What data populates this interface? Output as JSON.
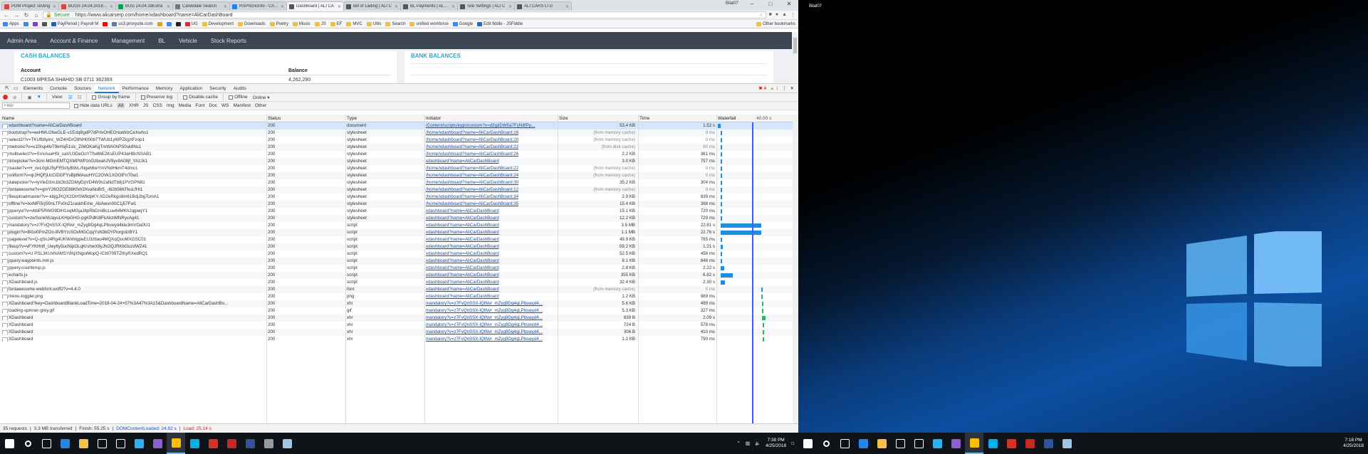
{
  "browser": {
    "profile": "Bilal07",
    "tabs": [
      {
        "label": "PDM Project Testing",
        "color": "#d44638"
      },
      {
        "label": "BUGS 24.04.2018 No",
        "color": "#d44638"
      },
      {
        "label": "BUG 24.04.18Extra",
        "color": "#0f9d58"
      },
      {
        "label": "Candidate Search",
        "color": "#777777"
      },
      {
        "label": "RSPNcricinfo - Cricke",
        "color": "#1e88e5"
      },
      {
        "label": "Dashboard | ALI CA",
        "color": "#555555"
      },
      {
        "label": "Bill of Lading | ALI C",
        "color": "#555555"
      },
      {
        "label": "BL Payments | ALI C",
        "color": "#555555"
      },
      {
        "label": "Site Settings | ALI C",
        "color": "#555555"
      },
      {
        "label": "ALI CARS LTD",
        "color": "#555555"
      }
    ],
    "active_tab": 5,
    "secure_label": "Secure",
    "url": "https://www.alicarserp.com/home/xdashboard?name=AliCarDashBoard",
    "bookmarks": [
      {
        "label": "Apps",
        "color": "#4285f4"
      },
      {
        "label": "",
        "color": "#3c8ad8"
      },
      {
        "label": "",
        "color": "#7b3fc4"
      },
      {
        "label": "",
        "color": "#555555"
      },
      {
        "label": "PayPeriod | Payroll M",
        "color": "#2563a8"
      },
      {
        "label": "",
        "color": "#ff0000"
      },
      {
        "label": "us3.proxysite.com",
        "color": "#5a7ea8"
      },
      {
        "label": "",
        "color": "#e0a020"
      },
      {
        "label": "",
        "color": "#4285f4"
      },
      {
        "label": "",
        "color": "#222222"
      },
      {
        "label": "UG",
        "color": "#d33030"
      },
      {
        "label": "Development",
        "color": "#e8c04a"
      },
      {
        "label": "Downloads",
        "color": "#e8c04a"
      },
      {
        "label": "Poetry",
        "color": "#e8c04a"
      },
      {
        "label": "Music",
        "color": "#e8c04a"
      },
      {
        "label": "JS",
        "color": "#e8c04a"
      },
      {
        "label": "EF",
        "color": "#e8c04a"
      },
      {
        "label": "MVC",
        "color": "#e8c04a"
      },
      {
        "label": "Utils",
        "color": "#e8c04a"
      },
      {
        "label": "Search",
        "color": "#e8c04a"
      },
      {
        "label": "unified workforce",
        "color": "#e8c04a"
      },
      {
        "label": "Google",
        "color": "#4285f4"
      },
      {
        "label": "Edit fiddle - JSFiddle",
        "color": "#2a6ab8"
      }
    ],
    "other_bookmarks": "Other bookmarks"
  },
  "app": {
    "nav": [
      "Admin Area",
      "Account & Finance",
      "Management",
      "BL",
      "Vehicle",
      "Stock Reports"
    ],
    "cash_title": "CASH BALANCES",
    "bank_title": "BANK BALANCES",
    "cash_headers": [
      "Account",
      "Balance"
    ],
    "cash_row": [
      "C1003 MPESA SHAHID SB 0711 362393",
      "4,262,290"
    ]
  },
  "devtools": {
    "tabs": [
      "Elements",
      "Console",
      "Sources",
      "Network",
      "Performance",
      "Memory",
      "Application",
      "Security",
      "Audits"
    ],
    "active_tab": "Network",
    "errors": "4",
    "warnings": "1",
    "toolbar": {
      "view": "View:",
      "group": "Group by frame",
      "preserve": "Preserve log",
      "disable_cache": "Disable cache",
      "offline": "Offline",
      "online": "Online"
    },
    "filter_placeholder": "Filter",
    "hide_data_urls": "Hide data URLs",
    "filter_types": [
      "All",
      "XHR",
      "JS",
      "CSS",
      "Img",
      "Media",
      "Font",
      "Doc",
      "WS",
      "Manifest",
      "Other"
    ],
    "columns": {
      "name": "Name",
      "status": "Status",
      "type": "Type",
      "initiator": "Initiator",
      "size": "Size",
      "time": "Time",
      "waterfall": "Waterfall",
      "waterfall_scale": "40.00 s"
    },
    "requests": [
      {
        "name": "xdashboard?name=AliCarDashBoard",
        "status": "200",
        "type": "document",
        "initiator": "/Content/scripts/login/custom?v=d2gdDW5a7FyN8fPp...",
        "size": "53.4 KB",
        "time": "1.52 s",
        "wf_start": 0.0,
        "wf_len": 1.52
      },
      {
        "name": "bootstrap?v=eeHMU26wGLE-v1EdqBgdP7dPrIvOHEOniaWizCeXwhs1",
        "status": "200",
        "type": "stylesheet",
        "initiator": "/home/xdashboard?name=AliCarDashBoard:16",
        "size": "(from memory cache)",
        "time": "0 ms",
        "wf_start": 1.5,
        "wf_len": 0.4
      },
      {
        "name": "select2/?v=TKUfb9yinc_WZ4HDrO9NH000b7TWUb1yWPZkgXFzop1",
        "status": "200",
        "type": "stylesheet",
        "initiator": "/home/xdashboard?name=AliCarDashBoard:20",
        "size": "(from memory cache)",
        "time": "0 ms",
        "wf_start": 1.5,
        "wf_len": 0.4
      },
      {
        "name": "metronic?v=u1fXsp4lvT9kHsj51slc_ZiMOKaKgTmWA0hPS0sk8Ns1",
        "status": "200",
        "type": "stylesheet",
        "initiator": "/home/xdashboard?name=AliCarDashBoard:22",
        "size": "(from disk cache)",
        "time": "60 ms",
        "wf_start": 1.5,
        "wf_len": 0.5
      },
      {
        "name": "multiselect?v=SVxAuaH5I_uaVU3DeOoYTfw8bE2KsEUP43aHBcNSAB1",
        "status": "200",
        "type": "stylesheet",
        "initiator": "/home/xdashboard?name=AliCarDashBoard:26",
        "size": "2.2 KB",
        "time": "361 ms",
        "wf_start": 1.5,
        "wf_len": 0.6
      },
      {
        "name": "timepicker?v=3cnr-MGmEMTQXMPWPznGzbxahJV9yv9A08jf_YAzJk1",
        "status": "200",
        "type": "stylesheet",
        "initiator": "xdashboard?name=AliCarDashBoard",
        "size": "3.0 KB",
        "time": "757 ms",
        "wf_start": 1.5,
        "wf_len": 0.9
      },
      {
        "name": "toaster?v=H_rwL0gbJ5yFR5ctyB9vLrNgeMiwYmVNdHkmT4dmc1",
        "status": "200",
        "type": "stylesheet",
        "initiator": "/home/xdashboard?name=AliCarDashBoard:22",
        "size": "(from memory cache)",
        "time": "0 ms",
        "wf_start": 1.5,
        "wf_len": 0.4
      },
      {
        "name": "uniform?v=qrJHQFjUcCiDGFYsBjdMAuuHYC2OVk1XOOtFnT0w1",
        "status": "200",
        "type": "stylesheet",
        "initiator": "/home/xdashboard?name=AliCarDashBoard:24",
        "size": "(from memory cache)",
        "time": "0 ms",
        "wf_start": 1.5,
        "wf_len": 0.4
      },
      {
        "name": "datepicker?v=tyVleD3m1bOb3ZGMyEqVD4W9v2aNdTb9j1PVGPN81",
        "status": "200",
        "type": "stylesheet",
        "initiator": "/home/xdashboard?name=AliCarDashBoard:30",
        "size": "35.2 KB",
        "time": "304 ms",
        "wf_start": 1.5,
        "wf_len": 0.6
      },
      {
        "name": "fontawesome?v=gmY26OZGE88Kfxh3XvaNoBr5_-6i2b56KFkuLfHI1",
        "status": "200",
        "type": "stylesheet",
        "initiator": "/home/xdashboard?name=AliCarDashBoard:12",
        "size": "(from memory cache)",
        "time": "0 ms",
        "wf_start": 1.5,
        "wf_len": 0.4
      },
      {
        "name": "fileuploadmaster?v=-kbjgJXQX2OHSW8dpKY-XD2eRkgo8m61BdjJbgTomA1",
        "status": "200",
        "type": "stylesheet",
        "initiator": "/home/xdashboard?name=AliCarDashBoard:34",
        "size": "2.9 KB",
        "time": "839 ms",
        "wf_start": 1.5,
        "wf_len": 0.9
      },
      {
        "name": "offline?v=lxxMFI5rjS0nLTFx0nZ1raskhErne_AbAwsn00C1j57Fw1",
        "status": "200",
        "type": "stylesheet",
        "initiator": "/home/xdashboard?name=AliCarDashBoard:35",
        "size": "15.4 KB",
        "time": "388 ms",
        "wf_start": 1.5,
        "wf_len": 0.6
      },
      {
        "name": "jqueryui?v=vbbP5RWG9DlH1oqMGjaJ8pRbDmiBcLue64MKh2qgwqY1",
        "status": "200",
        "type": "stylesheet",
        "initiator": "xdashboard?name=AliCarDashBoard",
        "size": "15.1 KB",
        "time": "720 ms",
        "wf_start": 1.5,
        "wf_len": 0.9
      },
      {
        "name": "custom?v=zwSonkNUayuLKHpGHG-pgKPdKI8FkAkziMNRyvAg41",
        "status": "200",
        "type": "stylesheet",
        "initiator": "xdashboard?name=AliCarDashBoard",
        "size": "12.2 KB",
        "time": "729 ms",
        "wf_start": 1.5,
        "wf_len": 0.9
      },
      {
        "name": "mandatory?v=z7FvQnSSX-lQtNvr_mZyg9Dg4qLPbswyd4kle3mVOa0U1",
        "status": "200",
        "type": "script",
        "initiator": "xdashboard?name=AliCarDashBoard",
        "size": "3.5 MB",
        "time": "22.81 s",
        "wf_start": 1.5,
        "wf_len": 22.81
      },
      {
        "name": "plugin?v=BGo0PmZOo-8VBYrcSOvMGCqqYsN3kDYPiorgolzBY1",
        "status": "200",
        "type": "script",
        "initiator": "xdashboard?name=AliCarDashBoard",
        "size": "1.1 MB",
        "time": "22.76 s",
        "wf_start": 1.5,
        "wf_len": 22.76
      },
      {
        "name": "pagelevel?v=Q-qSnJ4Rg4UKWxhtgpeEU3zttao4MQXqQuoMXGSC01",
        "status": "200",
        "type": "script",
        "initiator": "xdashboard?name=AliCarDashBoard",
        "size": "49.9 KB",
        "time": "765 ms",
        "wf_start": 1.5,
        "wf_len": 0.9
      },
      {
        "name": "fileup?v=vFYKHnfl_Uwy6y5ucNipOLqKrshwX8yJhOQJRKbGuzdWZ41",
        "status": "200",
        "type": "script",
        "initiator": "xdashboard?name=AliCarDashBoard",
        "size": "59.2 KB",
        "time": "1.21 s",
        "wf_start": 1.5,
        "wf_len": 1.21
      },
      {
        "name": "custom?v=U PSL3KUxNAMSY8hjXNgoiMopQ-ICW709TZthyRXedRQ1",
        "status": "200",
        "type": "script",
        "initiator": "xdashboard?name=AliCarDashBoard",
        "size": "52.5 KB",
        "time": "458 ms",
        "wf_start": 1.5,
        "wf_len": 0.7
      },
      {
        "name": "jquery.waypoints.min.js",
        "status": "200",
        "type": "script",
        "initiator": "xdashboard?name=AliCarDashBoard",
        "size": "8.1 KB",
        "time": "848 ms",
        "wf_start": 1.5,
        "wf_len": 0.9
      },
      {
        "name": "jquery.counterup.js",
        "status": "200",
        "type": "script",
        "initiator": "xdashboard?name=AliCarDashBoard",
        "size": "2.8 KB",
        "time": "2.22 s",
        "wf_start": 1.5,
        "wf_len": 2.22
      },
      {
        "name": "echarts.js",
        "status": "200",
        "type": "script",
        "initiator": "xdashboard?name=AliCarDashBoard",
        "size": "355 KB",
        "time": "6.82 s",
        "wf_start": 1.5,
        "wf_len": 6.82
      },
      {
        "name": "XDashboard.js",
        "status": "200",
        "type": "script",
        "initiator": "xdashboard?name=AliCarDashBoard",
        "size": "32.4 KB",
        "time": "2.30 s",
        "wf_start": 1.5,
        "wf_len": 2.3
      },
      {
        "name": "fontawesome-webfont.woff2?v=4.4.0",
        "status": "200",
        "type": "font",
        "initiator": "xdashboard?name=AliCarDashBoard",
        "size": "(from memory cache)",
        "time": "0 ms",
        "wf_start": 24.5,
        "wf_len": 0.3
      },
      {
        "name": "menu-toggler.png",
        "status": "200",
        "type": "png",
        "initiator": "xdashboard?name=AliCarDashBoard",
        "size": "1.2 KB",
        "time": "989 ms",
        "wf_start": 24.5,
        "wf_len": 0.5
      },
      {
        "name": "XDashboard?key=DashboardBlankLoadTime=2018-04-24+07%3A47%3A15&DashboardName=AliCarDashBo...",
        "status": "200",
        "type": "xhr",
        "initiator": "mandatory?v=z7FvQnSSX-lQtNvr_mZyg9Dg4qLPbswyd4...",
        "size": "5.6 KB",
        "time": "499 ms",
        "wf_start": 24.8,
        "wf_len": 0.5
      },
      {
        "name": "loading-spinner-grey.gif",
        "status": "200",
        "type": "gif",
        "initiator": "mandatory?v=z7FvQnSSX-lQtNvr_mZyg9Dg4qLPbswyd4...",
        "size": "5.3 KB",
        "time": "327 ms",
        "wf_start": 24.8,
        "wf_len": 0.4
      },
      {
        "name": "XDashboard",
        "status": "200",
        "type": "xhr",
        "initiator": "mandatory?v=z7FvQnSSX-lQtNvr_mZyg9Dg4qLPbswyd4...",
        "size": "839 B",
        "time": "2.09 s",
        "wf_start": 24.9,
        "wf_len": 2.09
      },
      {
        "name": "XDashboard",
        "status": "200",
        "type": "xhr",
        "initiator": "mandatory?v=z7FvQnSSX-lQtNvr_mZyg9Dg4qLPbswyd4...",
        "size": "724 B",
        "time": "578 ms",
        "wf_start": 25.0,
        "wf_len": 0.6
      },
      {
        "name": "XDashboard",
        "status": "200",
        "type": "xhr",
        "initiator": "mandatory?v=z7FvQnSSX-lQtNvr_mZyg9Dg4qLPbswyd4...",
        "size": "306 B",
        "time": "410 ms",
        "wf_start": 25.1,
        "wf_len": 0.5
      },
      {
        "name": "XDashboard",
        "status": "200",
        "type": "xhr",
        "initiator": "mandatory?v=z7FvQnSSX-lQtNvr_mZyg9Dg4qLPbswyd4...",
        "size": "1.2 KB",
        "time": "790 ms",
        "wf_start": 25.2,
        "wf_len": 0.8
      }
    ],
    "status_bar": {
      "requests": "35 requests",
      "transferred": "3.3 MB transferred",
      "finish": "Finish: 55.25 s",
      "dcl": "DOMContentLoaded: 24.82 s",
      "load": "Load: 25.14 s"
    }
  },
  "desktop": {
    "recycle_label": "Bilal07"
  },
  "taskbar_left": {
    "icons": [
      {
        "name": "start-icon",
        "color": "#ffffff"
      },
      {
        "name": "search-icon",
        "color": "#ffffff"
      },
      {
        "name": "task-view-icon",
        "color": "#ffffff"
      },
      {
        "name": "edge-icon",
        "color": "#1e88e5"
      },
      {
        "name": "file-explorer-icon",
        "color": "#f2c14e"
      },
      {
        "name": "store-icon",
        "color": "#ffffff"
      },
      {
        "name": "mail-icon",
        "color": "#ffffff"
      },
      {
        "name": "vs-code-icon",
        "color": "#2bb0f0"
      },
      {
        "name": "visual-studio-icon",
        "color": "#8e5fd0"
      },
      {
        "name": "chrome-icon",
        "color": "#fbbc05"
      },
      {
        "name": "skype-icon",
        "color": "#00aff0"
      },
      {
        "name": "sql-icon",
        "color": "#d93025"
      },
      {
        "name": "filezilla-icon",
        "color": "#c62828"
      },
      {
        "name": "word-icon",
        "color": "#2b579a"
      },
      {
        "name": "app-icon",
        "color": "#999999"
      },
      {
        "name": "notepad-icon",
        "color": "#9fc5e8"
      }
    ],
    "active_index": 9,
    "time": "7:38 PM",
    "date": "4/25/2018"
  },
  "taskbar_right": {
    "icons": [
      {
        "name": "start-icon",
        "color": "#ffffff"
      },
      {
        "name": "search-icon",
        "color": "#ffffff"
      },
      {
        "name": "task-view-icon",
        "color": "#ffffff"
      },
      {
        "name": "edge-icon",
        "color": "#1e88e5"
      },
      {
        "name": "file-explorer-icon",
        "color": "#f2c14e"
      },
      {
        "name": "store-icon",
        "color": "#ffffff"
      },
      {
        "name": "mail-icon",
        "color": "#ffffff"
      },
      {
        "name": "vs-code-icon",
        "color": "#2bb0f0"
      },
      {
        "name": "visual-studio-icon",
        "color": "#8e5fd0"
      },
      {
        "name": "chrome-icon",
        "color": "#fbbc05"
      },
      {
        "name": "skype-icon",
        "color": "#00aff0"
      },
      {
        "name": "sql-icon",
        "color": "#d93025"
      },
      {
        "name": "filezilla-icon",
        "color": "#c62828"
      },
      {
        "name": "word-icon",
        "color": "#2b579a"
      },
      {
        "name": "notepad-icon",
        "color": "#9fc5e8"
      }
    ],
    "active_index": 9,
    "time": "7:18 PM",
    "date": "4/25/2018"
  }
}
